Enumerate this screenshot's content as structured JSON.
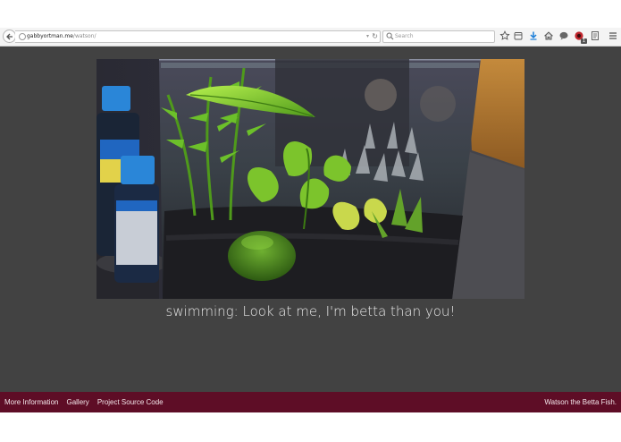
{
  "browser": {
    "url_host": "gabbyortman.me",
    "url_path": "/watson/",
    "search_placeholder": "Search",
    "addon_badge_count": "1",
    "icons": [
      "back-arrow-icon",
      "globe-icon",
      "dropdown-icon",
      "reload-icon",
      "search-icon",
      "bookmark-star-icon",
      "reading-list-icon",
      "download-icon",
      "home-icon",
      "chat-icon",
      "addon-icon",
      "reader-view-icon",
      "hamburger-menu-icon"
    ]
  },
  "main": {
    "image_alt": "Aquarium with Watson the betta fish",
    "caption": "swimming: Look at me, I'm betta than you!"
  },
  "footer": {
    "links": [
      "More Information",
      "Gallery",
      "Project Source Code"
    ],
    "brand": "Watson the Betta Fish."
  },
  "colors": {
    "page_background": "#424242",
    "footer_background": "#5e0d26",
    "footer_text": "#f2e6ea",
    "caption_text": "#e8e8e8"
  }
}
